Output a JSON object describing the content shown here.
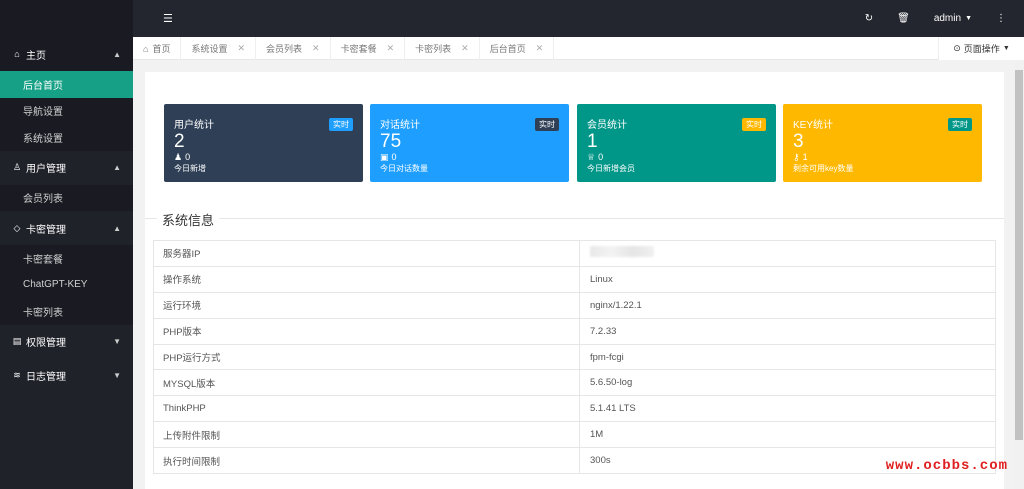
{
  "sidebar": {
    "groups": [
      {
        "label": "主页",
        "icon": "home-icon",
        "items": [
          "后台首页",
          "导航设置",
          "系统设置"
        ]
      },
      {
        "label": "用户管理",
        "icon": "user-icon",
        "items": [
          "会员列表"
        ]
      },
      {
        "label": "卡密管理",
        "icon": "tag-icon",
        "items": [
          "卡密套餐",
          "ChatGPT-KEY",
          "卡密列表"
        ]
      },
      {
        "label": "权限管理",
        "icon": "shield-icon",
        "items": []
      },
      {
        "label": "日志管理",
        "icon": "layers-icon",
        "items": []
      }
    ]
  },
  "header": {
    "user": "admin"
  },
  "tabs": {
    "items": [
      "首页",
      "系统设置",
      "会员列表",
      "卡密套餐",
      "卡密列表",
      "后台首页"
    ],
    "page_ops": "页面操作"
  },
  "cards": [
    {
      "title": "用户统计",
      "badge": "实时",
      "value": "2",
      "sub": "0",
      "note": "今日新增",
      "bg": "#2f4056",
      "badge_bg": "#1e9fff"
    },
    {
      "title": "对话统计",
      "badge": "实时",
      "value": "75",
      "sub": "0",
      "note": "今日对话数量",
      "bg": "#1e9fff",
      "badge_bg": "#2f4056"
    },
    {
      "title": "会员统计",
      "badge": "实时",
      "value": "1",
      "sub": "0",
      "note": "今日新增会员",
      "bg": "#009688",
      "badge_bg": "#ffb800"
    },
    {
      "title": "KEY统计",
      "badge": "实时",
      "value": "3",
      "sub": "1",
      "note": "剩余可用key数量",
      "bg": "#ffb800",
      "badge_bg": "#009688"
    }
  ],
  "system_info": {
    "title": "系统信息",
    "rows": [
      {
        "k": "服务器IP",
        "v": ""
      },
      {
        "k": "操作系统",
        "v": "Linux"
      },
      {
        "k": "运行环境",
        "v": "nginx/1.22.1"
      },
      {
        "k": "PHP版本",
        "v": "7.2.33"
      },
      {
        "k": "PHP运行方式",
        "v": "fpm-fcgi"
      },
      {
        "k": "MYSQL版本",
        "v": "5.6.50-log"
      },
      {
        "k": "ThinkPHP",
        "v": "5.1.41 LTS"
      },
      {
        "k": "上传附件限制",
        "v": "1M"
      },
      {
        "k": "执行时间限制",
        "v": "300s"
      }
    ]
  },
  "watermark": "www.ocbbs.com"
}
